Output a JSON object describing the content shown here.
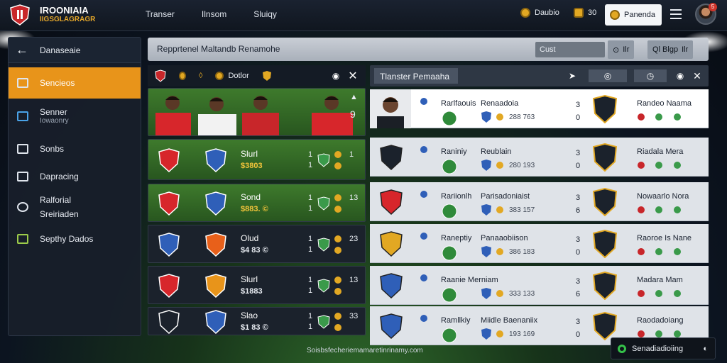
{
  "app": {
    "brand_title": "IROONIAIA",
    "brand_subtitle": "IIGSGLAGRAGR"
  },
  "topnav": [
    "Transer",
    "Ilnsom",
    "Sluiqy"
  ],
  "header_right": {
    "coin_label": "Daubio",
    "gems_value": "30",
    "wallet_label": "Panenda",
    "notification_count": "5"
  },
  "sidebar": {
    "back_label": "Danaseaie",
    "items": [
      {
        "label": "Sencieos",
        "sub": "",
        "icon": "document-icon"
      },
      {
        "label": "Senner",
        "sub": "Iowaonry",
        "icon": "flag-icon"
      },
      {
        "label": "Sonbs",
        "sub": "",
        "icon": "checkbox-icon"
      },
      {
        "label": "Dapracing",
        "sub": "",
        "icon": "list-icon"
      },
      {
        "label": "Ralforial",
        "sub": "Sreiriaden",
        "icon": "gear-icon"
      },
      {
        "label": "Septhy Dados",
        "sub": "",
        "icon": "transfer-icon"
      }
    ]
  },
  "search": {
    "title": "Repprtenel Maltandb Renamohe",
    "field_value": "Cust",
    "button_a_value": "Ilr",
    "button_b_label": "Ql Blgp",
    "button_b_value": "Ilr"
  },
  "left_panel": {
    "header_label": "Dotlor",
    "players_num": "9",
    "rows": [
      {
        "name": "Slurl",
        "price": "$3803",
        "n1": "1",
        "n2": "1",
        "style": "green"
      },
      {
        "name": "Sond",
        "price": "$883. ©",
        "n1": "1",
        "n2": "13",
        "style": "green"
      },
      {
        "name": "Olud",
        "price": "$4 83 ©",
        "n1": "1",
        "n2": "23",
        "style": "dark"
      },
      {
        "name": "Slurl",
        "price": "$1883",
        "n1": "1",
        "n2": "13",
        "style": "dark"
      },
      {
        "name": "Slao",
        "price": "$1 83 ©",
        "n1": "1",
        "n2": "33",
        "style": "dark"
      }
    ]
  },
  "right_panel": {
    "tab_label": "Tlanster Pemaaha",
    "rows": [
      {
        "name": "Rarlfaouis",
        "club": "Renaadoia",
        "price": "288 763",
        "a": "3",
        "b": "0",
        "right_name": "Randeo Naama"
      },
      {
        "name": "Raniniy",
        "club": "Reublain",
        "price": "280 193",
        "a": "3",
        "b": "0",
        "right_name": "Riadala Mera"
      },
      {
        "name": "Rariionlh",
        "club": "Parisadoniaist",
        "price": "383 157",
        "a": "3",
        "b": "6",
        "right_name": "Nowaarlo Nora"
      },
      {
        "name": "Raneptiy",
        "club": "Panaaobiison",
        "price": "386 183",
        "a": "3",
        "b": "0",
        "right_name": "Raoroe Is Nane"
      },
      {
        "name": "Raanie Merniam",
        "club": "",
        "price": "333 133",
        "a": "3",
        "b": "6",
        "right_name": "Madara Mam"
      },
      {
        "name": "Ramllkiy",
        "club": "Miidle Baenaniix",
        "price": "193 169",
        "a": "3",
        "b": "0",
        "right_name": "Raodadoiang"
      }
    ]
  },
  "footer": {
    "text": "Soisbsfecheriemamaretinrinamy.com",
    "status_label": "Senadiadioiing"
  },
  "colors": {
    "accent": "#e8941a",
    "green_row": "#3e7a2c",
    "panel_dark": "#1b222c"
  }
}
